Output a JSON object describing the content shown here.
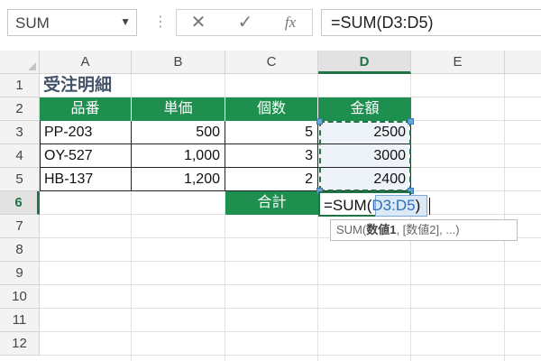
{
  "formula_bar": {
    "name_box": "SUM",
    "name_box_arrow": "▼",
    "separator": "⋮",
    "cancel_glyph": "✕",
    "enter_glyph": "✓",
    "fx_glyph": "fx",
    "formula": "=SUM(D3:D5)"
  },
  "columns": [
    "A",
    "B",
    "C",
    "D",
    "E"
  ],
  "rows": [
    "1",
    "2",
    "3",
    "4",
    "5",
    "6",
    "7",
    "8",
    "9",
    "10",
    "11",
    "12"
  ],
  "selected_column": "D",
  "selected_row": "6",
  "sheet": {
    "title": "受注明細",
    "headers": [
      "品番",
      "単価",
      "個数",
      "金額"
    ],
    "data": [
      {
        "code": "PP-203",
        "price": "500",
        "qty": "5",
        "amount": "2500"
      },
      {
        "code": "OY-527",
        "price": "1,000",
        "qty": "3",
        "amount": "3000"
      },
      {
        "code": "HB-137",
        "price": "1,200",
        "qty": "2",
        "amount": "2400"
      }
    ],
    "total_label": "合計"
  },
  "edit": {
    "prefix": "=SUM(",
    "range_ref": "D3:D5",
    "suffix": ")"
  },
  "tooltip": {
    "fn": "SUM(",
    "arg1": "数値1",
    "rest": ", [数値2], ...)"
  },
  "colors": {
    "header_green": "#1e8f4e",
    "title_text": "#44546a",
    "range_fill": "#eef3fa",
    "reference_blue": "#2f6fb6"
  }
}
